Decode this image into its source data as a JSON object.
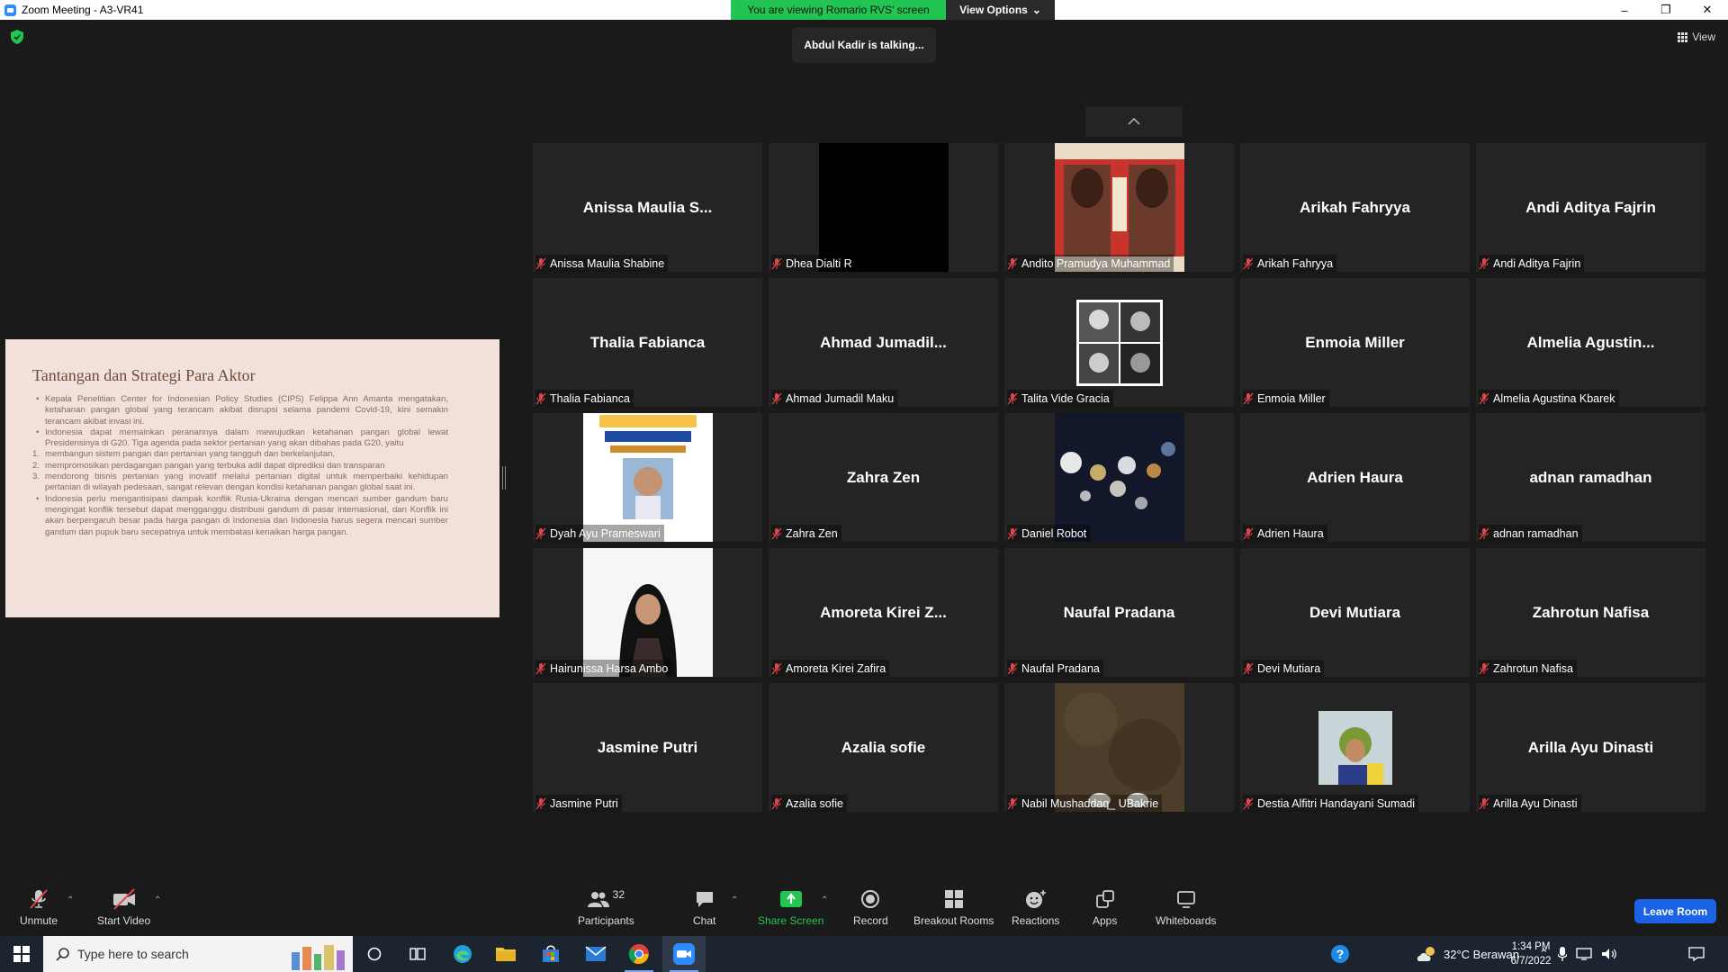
{
  "window": {
    "title": "Zoom Meeting - A3-VR41",
    "controls": [
      "–",
      "❐",
      "✕"
    ]
  },
  "share_banner": {
    "text": "You are viewing Romario RVS' screen",
    "view_options": "View Options"
  },
  "talking_indicator": "Abdul Kadir is talking...",
  "view_button": "View",
  "slide": {
    "title": "Tantangan dan Strategi Para Aktor",
    "items": [
      {
        "type": "bullet",
        "text": "Kepala Penelitian Center for Indonesian Policy Studies (CIPS) Felippa Ann Amanta mengatakan, ketahanan pangan global yang terancam akibat disrupsi selama pandemi Covid-19, kini semakin terancam akibat invasi ini."
      },
      {
        "type": "bullet",
        "text": "Indonesia dapat memainkan peranannya dalam mewujudkan ketahanan pangan global lewat Presidensinya di G20. Tiga agenda pada sektor pertanian yang akan dibahas pada G20, yaitu"
      },
      {
        "type": "number",
        "num": "1.",
        "text": "membangun sistem pangan dan pertanian yang tangguh dan berkelanjutan,"
      },
      {
        "type": "number",
        "num": "2.",
        "text": "mempromosikan perdagangan pangan yang terbuka adil dapat diprediksi dan transparan"
      },
      {
        "type": "number",
        "num": "3.",
        "text": "mendorong bisnis pertanian yang inovatif melalui pertanian digital untuk memperbaiki kehidupan pertanian di wilayah pedesaan, sangat relevan dengan kondisi ketahanan pangan global saat ini."
      },
      {
        "type": "bullet",
        "text": "Indonesia perlu mengantisipasi dampak konflik Rusia-Ukraina dengan mencari sumber gandum baru mengingat konflik tersebut dapat mengganggu distribusi gandum di pasar internasional, dan Konflik ini akan berpengaruh besar pada harga pangan di Indonesia dan Indonesia harus segera mencari sumber gandum dan pupuk baru secepatnya untuk membatasi kenaikan harga pangan."
      }
    ]
  },
  "participants": [
    {
      "center": "Anissa Maulia S...",
      "label": "Anissa Maulia Shabine",
      "video": "none"
    },
    {
      "center": "",
      "label": "Dhea Dialti R",
      "video": "black"
    },
    {
      "center": "",
      "label": "Andito Pramudya Muhammad",
      "video": "poster"
    },
    {
      "center": "Arikah Fahryya",
      "label": "Arikah Fahryya",
      "video": "none"
    },
    {
      "center": "Andi Aditya Fajrin",
      "label": "Andi Aditya Fajrin",
      "video": "none"
    },
    {
      "center": "Thalia Fabianca",
      "label": "Thalia Fabianca",
      "video": "none"
    },
    {
      "center": "Ahmad Jumadil...",
      "label": "Ahmad Jumadil Maku",
      "video": "none"
    },
    {
      "center": "",
      "label": "Talita Vide Gracia",
      "video": "photos"
    },
    {
      "center": "Enmoia Miller",
      "label": "Enmoia Miller",
      "video": "none"
    },
    {
      "center": "Almelia Agustin...",
      "label": "Almelia Agustina Kbarek",
      "video": "none"
    },
    {
      "center": "",
      "label": "Dyah Ayu Prameswari",
      "video": "summit"
    },
    {
      "center": "Zahra Zen",
      "label": "Zahra Zen",
      "video": "none"
    },
    {
      "center": "",
      "label": "Daniel Robot",
      "video": "bokeh"
    },
    {
      "center": "Adrien Haura",
      "label": "Adrien Haura",
      "video": "none"
    },
    {
      "center": "adnan ramadhan",
      "label": "adnan ramadhan",
      "video": "none"
    },
    {
      "center": "",
      "label": "Hairunissa Harsa Ambo",
      "video": "portrait"
    },
    {
      "center": "Amoreta Kirei Z...",
      "label": "Amoreta Kirei Zafira",
      "video": "none"
    },
    {
      "center": "Naufal Pradana",
      "label": "Naufal Pradana",
      "video": "none"
    },
    {
      "center": "Devi Mutiara",
      "label": "Devi Mutiara",
      "video": "none"
    },
    {
      "center": "Zahrotun Nafisa",
      "label": "Zahrotun Nafisa",
      "video": "none"
    },
    {
      "center": "Jasmine Putri",
      "label": "Jasmine Putri",
      "video": "none"
    },
    {
      "center": "Azalia sofie",
      "label": "Azalia sofie",
      "video": "none"
    },
    {
      "center": "",
      "label": "Nabil Mushaddaq_ UBakrie",
      "video": "ground"
    },
    {
      "center": "",
      "label": "Destia Alfitri Handayani Sumadi",
      "video": "small"
    },
    {
      "center": "Arilla Ayu Dinasti",
      "label": "Arilla Ayu Dinasti",
      "video": "none"
    }
  ],
  "toolbar": {
    "unmute": "Unmute",
    "start_video": "Start Video",
    "participants": "Participants",
    "participant_count": "32",
    "chat": "Chat",
    "share_screen": "Share Screen",
    "record": "Record",
    "breakout": "Breakout Rooms",
    "reactions": "Reactions",
    "apps": "Apps",
    "whiteboards": "Whiteboards",
    "leave": "Leave Room"
  },
  "taskbar": {
    "search_placeholder": "Type here to search",
    "weather": "32°C  Berawan",
    "time": "1:34 PM",
    "date": "6/7/2022"
  },
  "colors": {
    "share_green": "#23c552",
    "leave_blue": "#1a62e6",
    "mic_red": "#e0454a",
    "tile_bg": "#242424"
  }
}
